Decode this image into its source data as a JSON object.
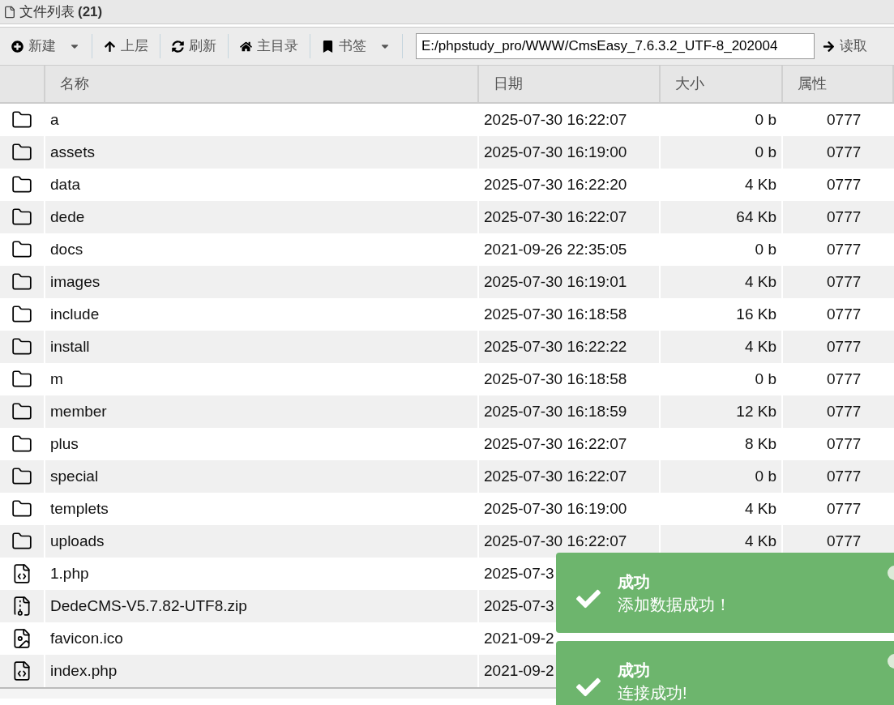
{
  "panel": {
    "title": "文件列表",
    "count": "(21)"
  },
  "toolbar": [
    {
      "label": "新建",
      "kind": "new",
      "dropdown": true
    },
    {
      "label": "上层",
      "kind": "up",
      "dropdown": false
    },
    {
      "label": "刷新",
      "kind": "refresh",
      "dropdown": false
    },
    {
      "label": "主目录",
      "kind": "home",
      "dropdown": false
    },
    {
      "label": "书签",
      "kind": "bookmark",
      "dropdown": true
    }
  ],
  "path": {
    "value": "E:/phpstudy_pro/WWW/CmsEasy_7.6.3.2_UTF-8_202004"
  },
  "read_button": {
    "label": "读取"
  },
  "columns": [
    "名称",
    "日期",
    "大小",
    "属性"
  ],
  "rows": [
    {
      "kind": "folder",
      "name": "a",
      "date": "2025-07-30 16:22:07",
      "size": "0 b",
      "attr": "0777"
    },
    {
      "kind": "folder",
      "name": "assets",
      "date": "2025-07-30 16:19:00",
      "size": "0 b",
      "attr": "0777"
    },
    {
      "kind": "folder",
      "name": "data",
      "date": "2025-07-30 16:22:20",
      "size": "4 Kb",
      "attr": "0777"
    },
    {
      "kind": "folder",
      "name": "dede",
      "date": "2025-07-30 16:22:07",
      "size": "64 Kb",
      "attr": "0777"
    },
    {
      "kind": "folder",
      "name": "docs",
      "date": "2021-09-26 22:35:05",
      "size": "0 b",
      "attr": "0777"
    },
    {
      "kind": "folder",
      "name": "images",
      "date": "2025-07-30 16:19:01",
      "size": "4 Kb",
      "attr": "0777"
    },
    {
      "kind": "folder",
      "name": "include",
      "date": "2025-07-30 16:18:58",
      "size": "16 Kb",
      "attr": "0777"
    },
    {
      "kind": "folder",
      "name": "install",
      "date": "2025-07-30 16:22:22",
      "size": "4 Kb",
      "attr": "0777"
    },
    {
      "kind": "folder",
      "name": "m",
      "date": "2025-07-30 16:18:58",
      "size": "0 b",
      "attr": "0777"
    },
    {
      "kind": "folder",
      "name": "member",
      "date": "2025-07-30 16:18:59",
      "size": "12 Kb",
      "attr": "0777"
    },
    {
      "kind": "folder",
      "name": "plus",
      "date": "2025-07-30 16:22:07",
      "size": "8 Kb",
      "attr": "0777"
    },
    {
      "kind": "folder",
      "name": "special",
      "date": "2025-07-30 16:22:07",
      "size": "0 b",
      "attr": "0777"
    },
    {
      "kind": "folder",
      "name": "templets",
      "date": "2025-07-30 16:19:00",
      "size": "4 Kb",
      "attr": "0777"
    },
    {
      "kind": "folder",
      "name": "uploads",
      "date": "2025-07-30 16:22:07",
      "size": "4 Kb",
      "attr": "0777"
    },
    {
      "kind": "code",
      "name": "1.php",
      "date": "2025-07-3"
    },
    {
      "kind": "zip",
      "name": "DedeCMS-V5.7.82-UTF8.zip",
      "date": "2025-07-3"
    },
    {
      "kind": "image",
      "name": "favicon.ico",
      "date": "2021-09-2"
    },
    {
      "kind": "code",
      "name": "index.php",
      "date": "2021-09-2"
    }
  ],
  "toasts": [
    {
      "title": "成功",
      "message": "添加数据成功！"
    },
    {
      "title": "成功",
      "message": "连接成功!"
    }
  ]
}
